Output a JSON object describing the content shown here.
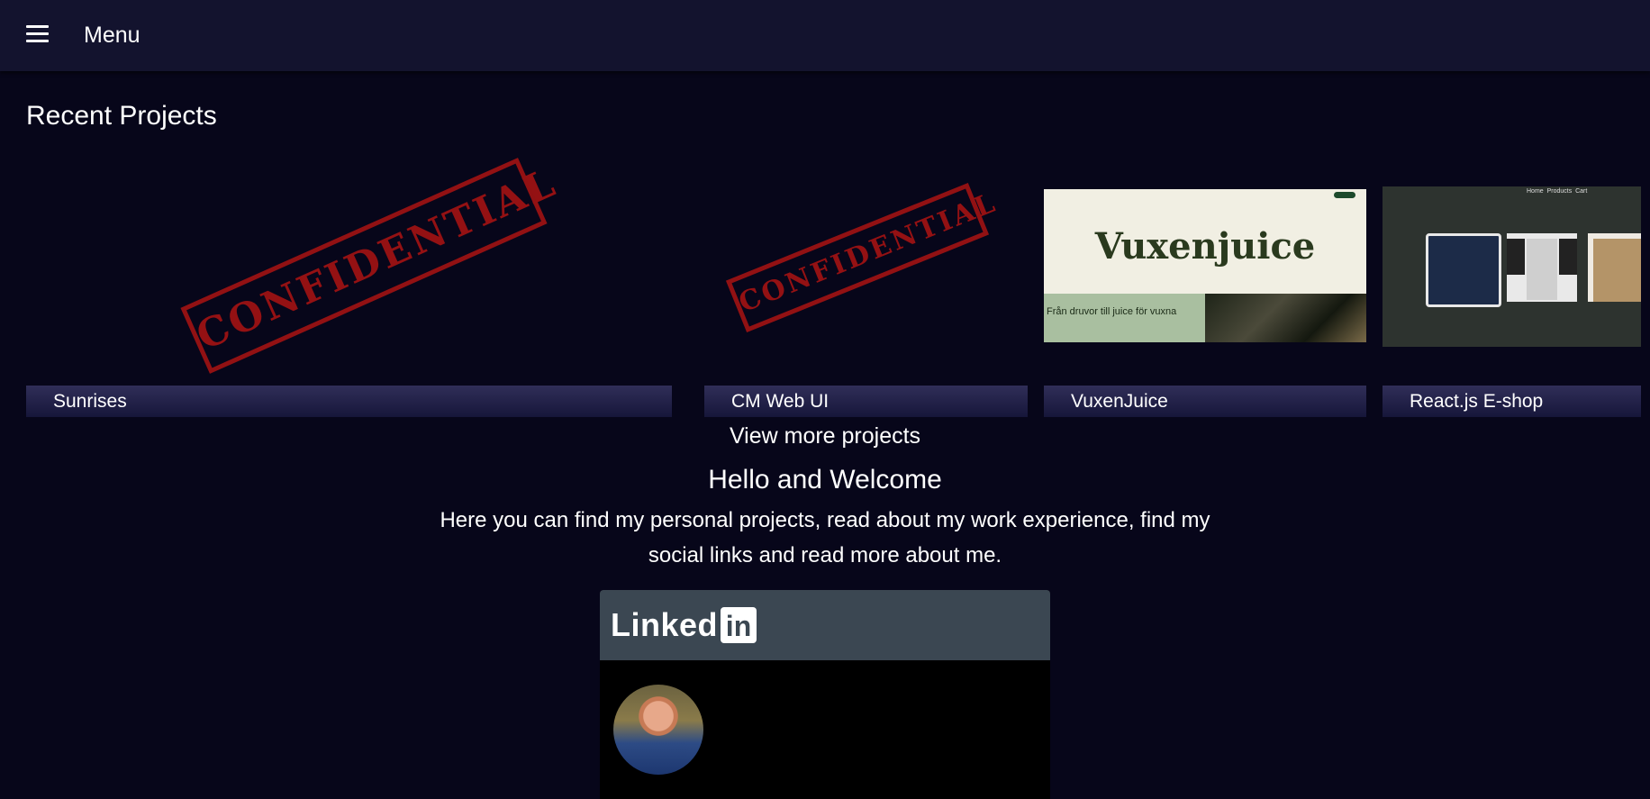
{
  "header": {
    "menu_label": "Menu"
  },
  "recent_projects": {
    "title": "Recent Projects",
    "projects": [
      {
        "name": "Sunrises",
        "thumbnail": "confidential-stamp"
      },
      {
        "name": "CM Web UI",
        "thumbnail": "confidential-stamp"
      },
      {
        "name": "VuxenJuice",
        "thumbnail": "vuxenjuice-screenshot"
      },
      {
        "name": "React.js E-shop",
        "thumbnail": "eshop-screenshot"
      }
    ],
    "stamp_text": "CONFIDENTIAL",
    "vuxenjuice_thumb": {
      "brand": "Vuxenjuice",
      "tagline": "Från druvor till juice för vuxna"
    },
    "eshop_thumb": {
      "nav": [
        "Home",
        "Products",
        "Cart"
      ]
    }
  },
  "view_more": "View more projects",
  "welcome": {
    "title": "Hello and Welcome",
    "text": "Here you can find my personal projects, read about my work experience, find my social links and read more about me."
  },
  "linkedin": {
    "word": "Linked",
    "badge": "in"
  },
  "colors": {
    "background": "#07061a",
    "topbar": "#13132e",
    "stamp": "#a01313",
    "linkedin_header": "#3b4752"
  }
}
